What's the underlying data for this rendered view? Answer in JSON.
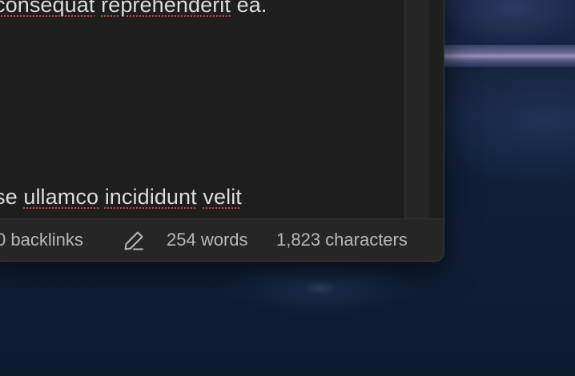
{
  "editor": {
    "lines": [
      {
        "words": [
          "consequat",
          "reprehenderit",
          "ea."
        ]
      },
      {
        "words": [
          "se",
          "ullamco",
          "incididunt",
          "velit"
        ]
      }
    ]
  },
  "status_bar": {
    "backlinks": "0 backlinks",
    "edit_icon": "pencil-icon",
    "words": "254 words",
    "characters": "1,823 characters"
  },
  "colors": {
    "window_bg": "#1f1f1f",
    "status_text": "#b8b8b8",
    "spellcheck_underline": "#c94545"
  }
}
